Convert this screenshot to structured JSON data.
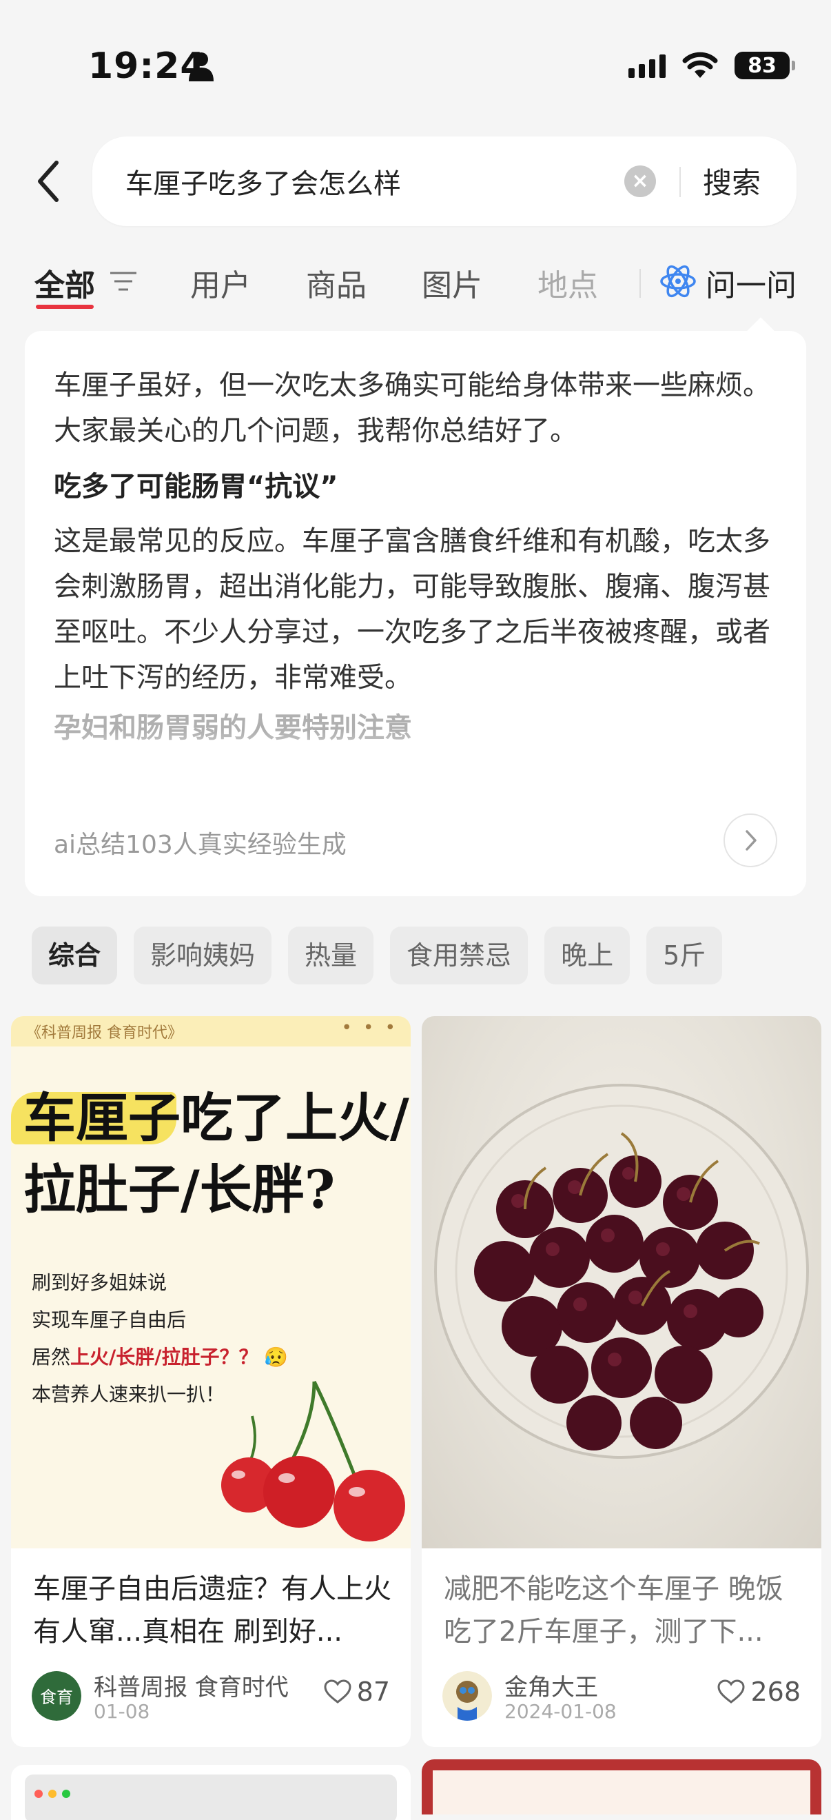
{
  "status_bar": {
    "time": "19:24",
    "battery": "83"
  },
  "search": {
    "query": "车厘子吃多了会怎么样",
    "button_label": "搜索",
    "clear_icon": "close-circle-icon",
    "back_icon": "chevron-left-icon"
  },
  "tabs": {
    "all": "全部",
    "users": "用户",
    "products": "商品",
    "images": "图片",
    "places": "地点",
    "ask": "问一问",
    "accent_color": "#e8343f"
  },
  "ai_summary": {
    "intro": "车厘子虽好，但一次吃太多确实可能给身体带来一些麻烦。大家最关心的几个问题，我帮你总结好了。",
    "section1_title": "吃多了可能肠胃“抗议”",
    "section1_body": "这是最常见的反应。车厘子富含膳食纤维和有机酸，吃太多会刺激肠胃，超出消化能力，可能导致腹胀、腹痛、腹泻甚至呕吐。不少人分享过，一次吃多了之后半夜被疼醒，或者上吐下泻的经历，非常难受。",
    "section2_title": "孕妇和肠胃弱的人要特别注意",
    "footer": "ai总结103人真实经验生成"
  },
  "chips": [
    "综合",
    "影响姨妈",
    "热量",
    "食用禁忌",
    "晚上",
    "5斤"
  ],
  "cards": [
    {
      "title": "车厘子自由后遗症？有人上火有人窜...真相在 刷到好...",
      "author": "科普周报 食育时代",
      "date": "01-08",
      "likes": "87",
      "poster": {
        "bar": "《科普周报 食育时代》",
        "dots": "• • •",
        "headline_1": "车厘子吃了上火/",
        "headline_2": "拉肚子/长胖?",
        "line1": "刷到好多姐妹说",
        "line2": "实现车厘子自由后",
        "line3_prefix": "居然",
        "line3_red": "上火/长胖/拉肚子？？",
        "line4": "本营养人速来扒一扒！",
        "avatar_text": "食育"
      }
    },
    {
      "title": "减肥不能吃这个车厘子 晚饭吃了2斤车厘子，测了下...",
      "author": "金角大王",
      "date": "2024-01-08",
      "likes": "268"
    }
  ]
}
